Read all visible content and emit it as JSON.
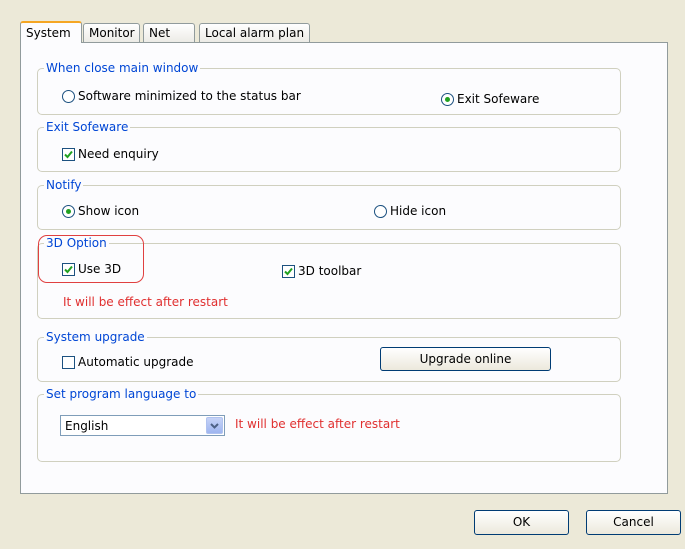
{
  "tabs": [
    "System",
    "Monitor",
    "Net",
    "Local alarm plan"
  ],
  "close_group": {
    "legend": "When close main window",
    "opt_minimize": "Software minimized to the status bar",
    "opt_exit": "Exit Sofeware",
    "selected": "opt_exit"
  },
  "exit_group": {
    "legend": "Exit Sofeware",
    "need_enquiry": "Need enquiry",
    "need_enquiry_checked": true
  },
  "notify_group": {
    "legend": "Notify",
    "show_icon": "Show icon",
    "hide_icon": "Hide icon",
    "selected": "show_icon"
  },
  "option_3d_group": {
    "legend": "3D Option",
    "use_3d": "Use 3D",
    "use_3d_checked": true,
    "toolbar_3d": "3D toolbar",
    "toolbar_3d_checked": true,
    "restart_note": "It will be effect after restart"
  },
  "upgrade_group": {
    "legend": "System upgrade",
    "automatic_upgrade": "Automatic upgrade",
    "automatic_checked": false,
    "upgrade_online_button": "Upgrade online"
  },
  "language_group": {
    "legend": "Set program language to",
    "selected_language": "English",
    "restart_note": "It will be effect after restart"
  },
  "footer": {
    "ok": "OK",
    "cancel": "Cancel"
  },
  "colors": {
    "legend": "#0046d5",
    "warning": "#e03030",
    "highlight": "#e04040",
    "check": "#21a121"
  }
}
